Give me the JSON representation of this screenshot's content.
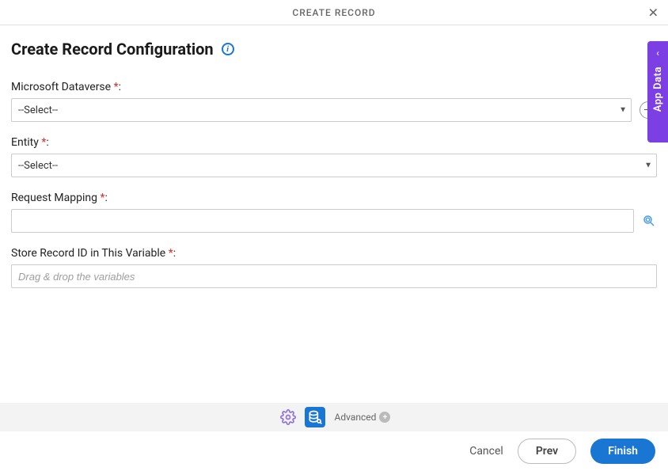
{
  "header": {
    "title": "CREATE RECORD"
  },
  "page": {
    "title": "Create Record Configuration"
  },
  "fields": {
    "dataverse": {
      "label": "Microsoft Dataverse",
      "value": "--Select--"
    },
    "entity": {
      "label": "Entity",
      "value": "--Select--"
    },
    "requestMapping": {
      "label": "Request Mapping",
      "value": ""
    },
    "storeVar": {
      "label": "Store Record ID in This Variable",
      "placeholder": "Drag & drop the variables",
      "value": ""
    }
  },
  "sidebar": {
    "label": "App Data"
  },
  "toolbar": {
    "advanced": "Advanced"
  },
  "footer": {
    "cancel": "Cancel",
    "prev": "Prev",
    "finish": "Finish"
  }
}
